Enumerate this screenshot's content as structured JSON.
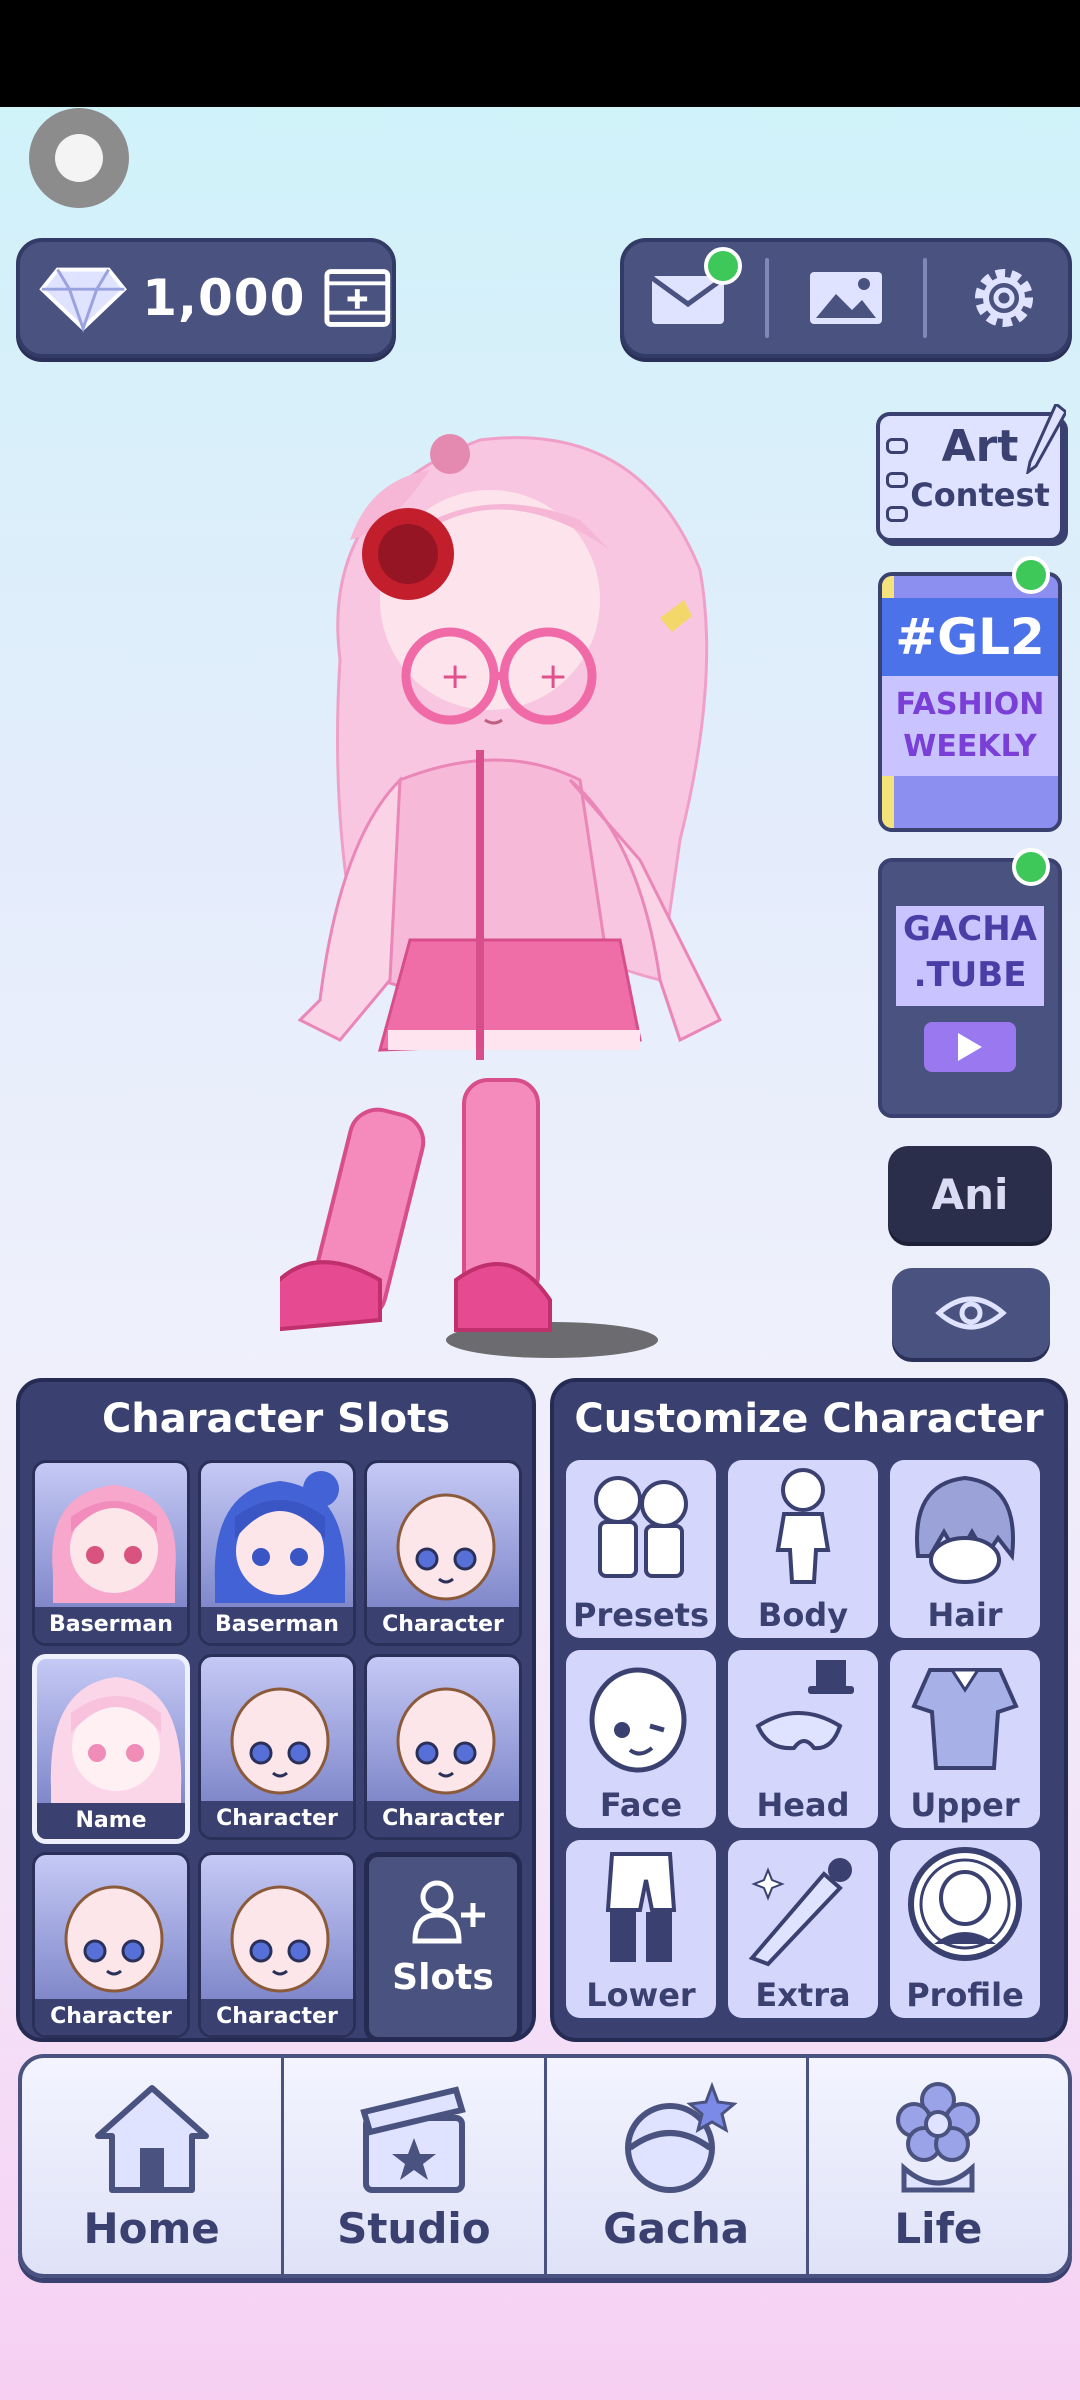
{
  "currency": {
    "amount": "1,000",
    "icon": "diamond-icon",
    "add_icon": "add-currency-icon"
  },
  "topbar": {
    "mail_icon": "mail-icon",
    "gallery_icon": "gallery-icon",
    "settings_icon": "gear-icon",
    "mail_has_notification": true
  },
  "side_cards": {
    "art_contest": {
      "line1": "Art",
      "line2": "Contest"
    },
    "fashion": {
      "line1": "#GL2",
      "line2": "FASHION",
      "line3": "WEEKLY",
      "has_notification": true
    },
    "gacha_tube": {
      "line1": "GACHA",
      "line2": ".TUBE",
      "has_notification": true
    }
  },
  "ani_button": {
    "label": "Ani"
  },
  "visibility_button": {
    "icon": "eye-icon"
  },
  "character_slots": {
    "title": "Character Slots",
    "slots": [
      {
        "label": "Baserman",
        "face": "pink-hair"
      },
      {
        "label": "Baserman",
        "face": "blue-hair"
      },
      {
        "label": "Character",
        "face": "bald"
      },
      {
        "label": "Name",
        "face": "pale-pink-hair",
        "selected": true
      },
      {
        "label": "Character",
        "face": "bald"
      },
      {
        "label": "Character",
        "face": "bald"
      },
      {
        "label": "Character",
        "face": "bald"
      },
      {
        "label": "Character",
        "face": "bald"
      }
    ],
    "add_slots_label": "Slots"
  },
  "customize": {
    "title": "Customize Character",
    "items": [
      {
        "label": "Presets",
        "icon": "presets-icon"
      },
      {
        "label": "Body",
        "icon": "body-icon"
      },
      {
        "label": "Hair",
        "icon": "hair-icon"
      },
      {
        "label": "Face",
        "icon": "face-icon"
      },
      {
        "label": "Head",
        "icon": "head-icon"
      },
      {
        "label": "Upper",
        "icon": "upper-icon"
      },
      {
        "label": "Lower",
        "icon": "lower-icon"
      },
      {
        "label": "Extra",
        "icon": "extra-icon"
      },
      {
        "label": "Profile",
        "icon": "profile-icon"
      }
    ]
  },
  "nav": {
    "items": [
      {
        "label": "Home",
        "icon": "house-icon"
      },
      {
        "label": "Studio",
        "icon": "clapperboard-icon"
      },
      {
        "label": "Gacha",
        "icon": "gacha-icon"
      },
      {
        "label": "Life",
        "icon": "flower-icon"
      }
    ]
  },
  "colors": {
    "panel": "#4a5280",
    "panel_dark": "#3a4170",
    "tile": "#d4d6fb",
    "notify": "#3ec85a"
  }
}
